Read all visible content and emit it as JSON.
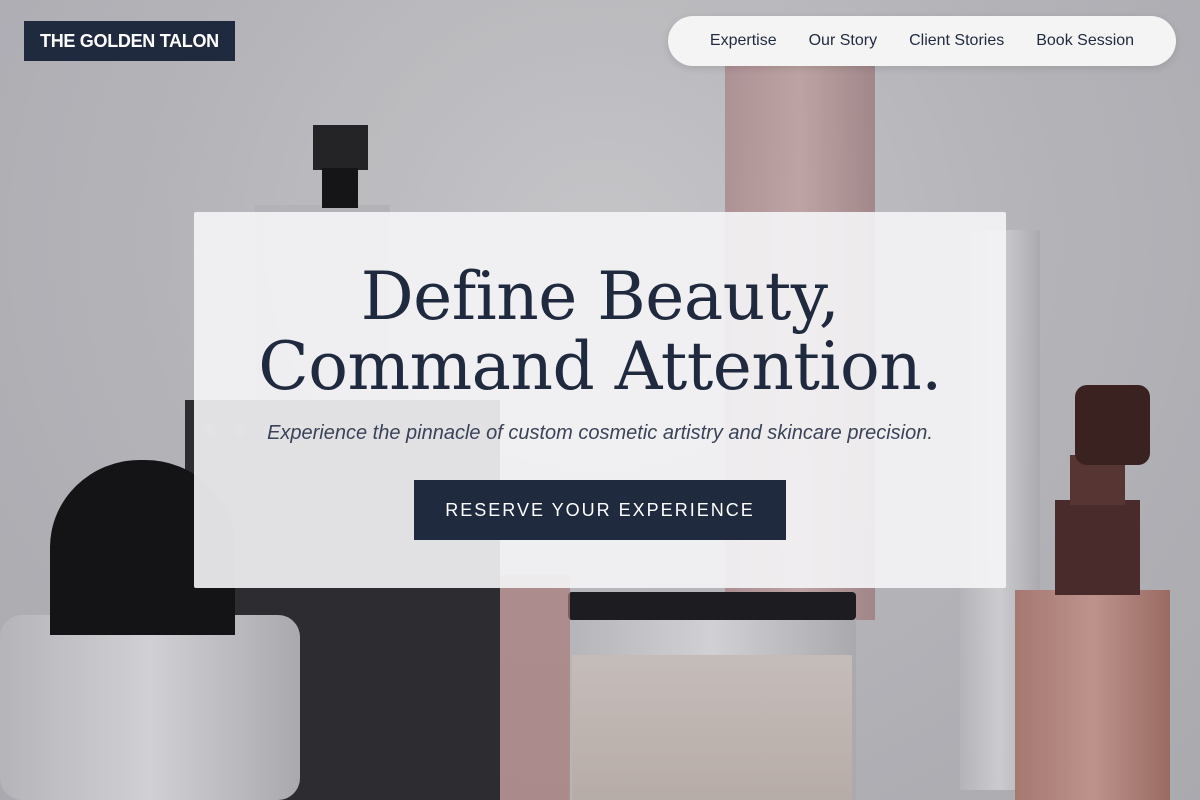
{
  "brand": {
    "name": "THE GOLDEN TALON"
  },
  "nav": {
    "items": [
      {
        "label": "Expertise"
      },
      {
        "label": "Our Story"
      },
      {
        "label": "Client Stories"
      },
      {
        "label": "Book Session"
      }
    ]
  },
  "hero": {
    "headline_line1": "Define Beauty,",
    "headline_line2": "Command Attention.",
    "subtitle": "Experience the pinnacle of custom cosmetic artistry and skincare precision.",
    "cta_label": "RESERVE YOUR EXPERIENCE"
  },
  "colors": {
    "navy": "#1f2a3f",
    "nav_pill": "#f4f4f5",
    "card": "#f5f5f7"
  },
  "background": {
    "description_icon": "cosmetic-bottles-photo"
  }
}
